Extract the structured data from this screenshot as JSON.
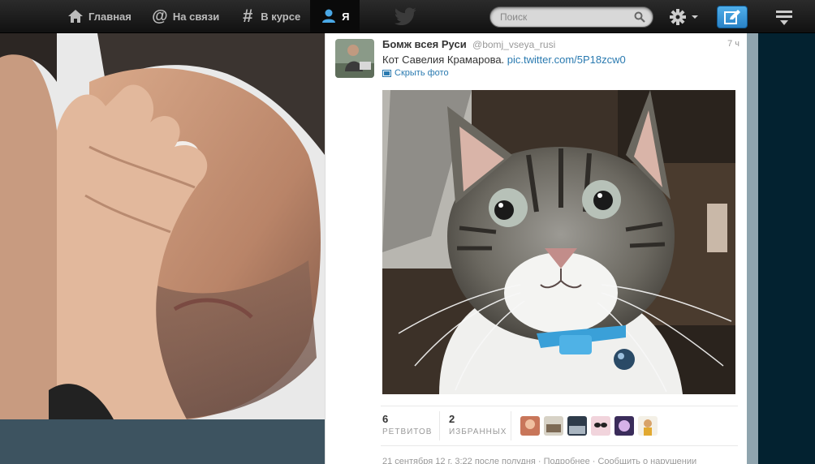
{
  "nav": {
    "home_label": "Главная",
    "connect_label": "На связи",
    "discover_label": "В курсе",
    "me_label": "Я",
    "home_icon": "house-icon",
    "connect_icon": "at-icon",
    "discover_icon": "hash-icon",
    "me_icon": "person-icon"
  },
  "search": {
    "placeholder": "Поиск"
  },
  "colors": {
    "topbar": "#1e1e1e",
    "compose": "#3a97d9",
    "link": "#2a7ab0",
    "page_bg": "#3d5360"
  },
  "tweet": {
    "author": "Бомж всея Руси",
    "handle": "@bomj_vseya_rusi",
    "time": "7 ч",
    "text": "Кот Савелия Крамарова.",
    "link": "pic.twitter.com/5P18zcw0",
    "hide_photo": "Скрыть фото",
    "retweets_count": "6",
    "retweets_label": "РЕТВИТОВ",
    "favorites_count": "2",
    "favorites_label": "ИЗБРАННЫХ",
    "footer_date": "21 сентября 12 г. 3:22",
    "footer_app": "после полудня",
    "footer_details": "Подробнее",
    "footer_report": "Сообщить о нарушении"
  }
}
